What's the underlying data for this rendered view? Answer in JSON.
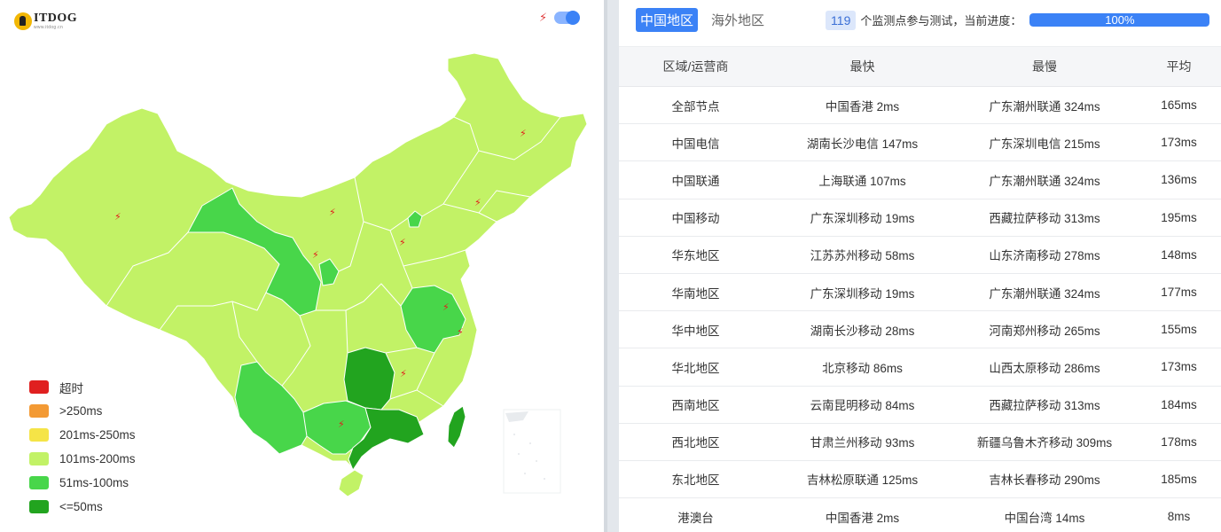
{
  "logo": {
    "name": "ITDOG",
    "url": "www.itdog.cn"
  },
  "legend": [
    {
      "label": "超时",
      "color": "#e02020"
    },
    {
      "label": ">250ms",
      "color": "#f39a34"
    },
    {
      "label": "201ms-250ms",
      "color": "#f5e447"
    },
    {
      "label": "101ms-200ms",
      "color": "#c2f266"
    },
    {
      "label": "51ms-100ms",
      "color": "#48d64a"
    },
    {
      "label": "<=50ms",
      "color": "#22a41f"
    }
  ],
  "map": {
    "icons": {
      "bolt": "lightning-icon",
      "toggle": "toggle-switch"
    },
    "map_lightning_toggle_on": true
  },
  "tabs": {
    "active": "中国地区",
    "inactive": "海外地区"
  },
  "progress": {
    "count": "119",
    "text": "个监测点参与测试，当前进度：",
    "label": "100%",
    "value": 1.0
  },
  "colors": {
    "accent": "#3b82f6"
  },
  "table": {
    "headers": [
      "区域/运营商",
      "最快",
      "最慢",
      "平均"
    ],
    "rows": [
      [
        "全部节点",
        "中国香港 2ms",
        "广东潮州联通 324ms",
        "165ms"
      ],
      [
        "中国电信",
        "湖南长沙电信 147ms",
        "广东深圳电信 215ms",
        "173ms"
      ],
      [
        "中国联通",
        "上海联通 107ms",
        "广东潮州联通 324ms",
        "136ms"
      ],
      [
        "中国移动",
        "广东深圳移动 19ms",
        "西藏拉萨移动 313ms",
        "195ms"
      ],
      [
        "华东地区",
        "江苏苏州移动 58ms",
        "山东济南移动 278ms",
        "148ms"
      ],
      [
        "华南地区",
        "广东深圳移动 19ms",
        "广东潮州联通 324ms",
        "177ms"
      ],
      [
        "华中地区",
        "湖南长沙移动 28ms",
        "河南郑州移动 265ms",
        "155ms"
      ],
      [
        "华北地区",
        "北京移动 86ms",
        "山西太原移动 286ms",
        "173ms"
      ],
      [
        "西南地区",
        "云南昆明移动 84ms",
        "西藏拉萨移动 313ms",
        "184ms"
      ],
      [
        "西北地区",
        "甘肃兰州移动 93ms",
        "新疆乌鲁木齐移动 309ms",
        "178ms"
      ],
      [
        "东北地区",
        "吉林松原联通 125ms",
        "吉林长春移动 290ms",
        "185ms"
      ],
      [
        "港澳台",
        "中国香港 2ms",
        "中国台湾 14ms",
        "8ms"
      ]
    ]
  }
}
